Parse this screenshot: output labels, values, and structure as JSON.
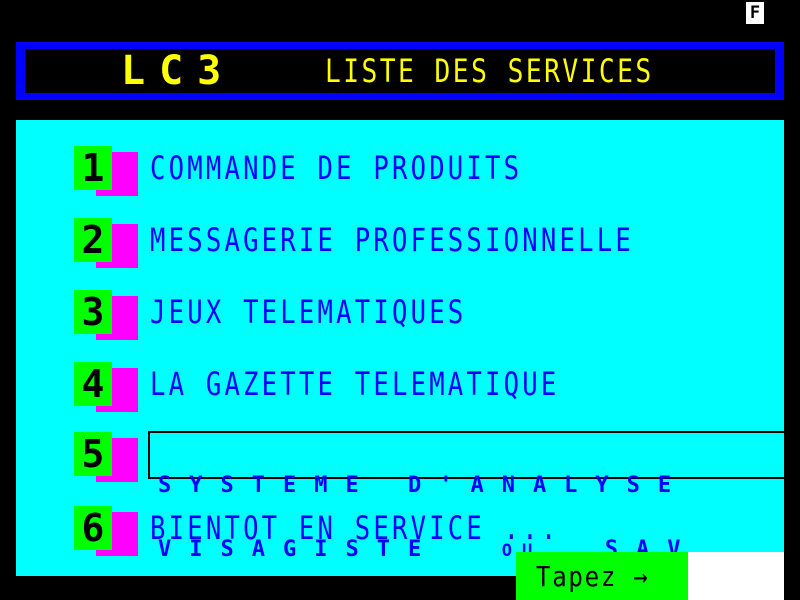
{
  "status": {
    "indicator": "F"
  },
  "header": {
    "logo": "LC3",
    "title": "LISTE DES SERVICES"
  },
  "menu": {
    "items": [
      {
        "number": "1",
        "label": "COMMANDE DE PRODUITS"
      },
      {
        "number": "2",
        "label": "MESSAGERIE PROFESSIONNELLE"
      },
      {
        "number": "3",
        "label": "JEUX TELEMATIQUES"
      },
      {
        "number": "4",
        "label": "LA GAZETTE TELEMATIQUE"
      },
      {
        "number": "5",
        "line1": "SYSTEME D'ANALYSE",
        "line2_a": "VISAGISTE",
        "line2_or": "OU",
        "line2_b": "SAV"
      },
      {
        "number": "6",
        "label": "BIENTOT EN SERVICE ..."
      }
    ]
  },
  "prompt": {
    "label": "Tapez →",
    "input_value": ""
  },
  "colors": {
    "background": "#000000",
    "panel": "#00ffff",
    "header_border": "#0000ff",
    "header_text": "#ffff00",
    "menu_text": "#0000ff",
    "number_box": "#00ff00",
    "number_shadow": "#ff00ff"
  }
}
